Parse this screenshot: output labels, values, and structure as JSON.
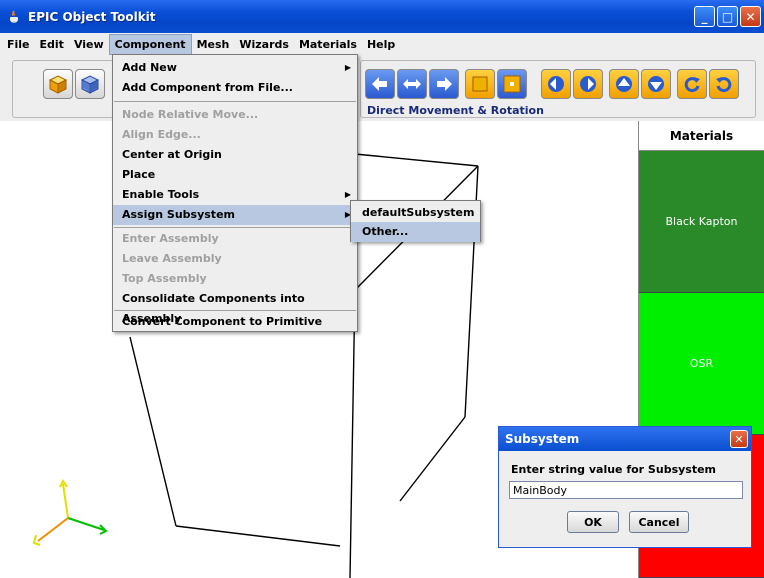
{
  "window": {
    "title": "EPIC Object Toolkit",
    "min_glyph": "_",
    "max_glyph": "□",
    "close_glyph": "✕"
  },
  "menubar": {
    "items": [
      "File",
      "Edit",
      "View",
      "Component",
      "Mesh",
      "Wizards",
      "Materials",
      "Help"
    ],
    "active": "Component"
  },
  "toolbar": {
    "direct_movement_label": "Direct Movement & Rotation"
  },
  "component_menu": {
    "items": [
      {
        "label": "Add New",
        "enabled": true,
        "submenu": true
      },
      {
        "label": "Add Component from File...",
        "enabled": true,
        "submenu": false
      },
      {
        "label": "Node Relative Move...",
        "enabled": false,
        "submenu": false
      },
      {
        "label": "Align Edge...",
        "enabled": false,
        "submenu": false
      },
      {
        "label": "Center at Origin",
        "enabled": true,
        "submenu": false
      },
      {
        "label": "Place",
        "enabled": true,
        "submenu": false
      },
      {
        "label": "Enable Tools",
        "enabled": true,
        "submenu": true
      },
      {
        "label": "Assign Subsystem",
        "enabled": true,
        "submenu": true,
        "highlighted": true
      },
      {
        "label": "Enter Assembly",
        "enabled": false,
        "submenu": false
      },
      {
        "label": "Leave Assembly",
        "enabled": false,
        "submenu": false
      },
      {
        "label": "Top Assembly",
        "enabled": false,
        "submenu": false
      },
      {
        "label": "Consolidate Components into Assembly",
        "enabled": true,
        "submenu": false
      },
      {
        "label": "Convert Component to Primitive",
        "enabled": true,
        "submenu": false
      }
    ]
  },
  "subsystem_submenu": {
    "items": [
      "defaultSubsystem",
      "Other..."
    ],
    "highlighted": "Other..."
  },
  "materials": {
    "header": "Materials",
    "swatches": [
      {
        "label": "Black Kapton",
        "color": "#2a8a2a"
      },
      {
        "label": "OSR",
        "color": "#00ee00"
      },
      {
        "label": "",
        "color": "#ff0000"
      }
    ]
  },
  "dialog": {
    "title": "Subsystem",
    "prompt": "Enter string value for Subsystem",
    "input_value": "MainBody",
    "ok_label": "OK",
    "cancel_label": "Cancel"
  },
  "colors": {
    "titlebar": "#0a50d8",
    "menu_highlight": "#b8c8e0",
    "toolbar_button_orange": "#f0a000",
    "toolbar_button_blue": "#2a5ad0"
  }
}
